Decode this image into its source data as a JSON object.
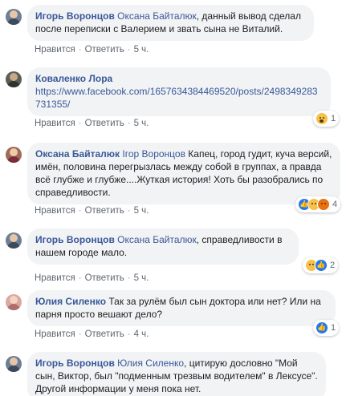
{
  "comments": [
    {
      "author": "Игорь Воронцов",
      "mention": "Оксана Байталюк",
      "text": ", данный вывод сделал после переписки с Валерием и звать сына не Виталий.",
      "like": "Нравится",
      "reply": "Ответить",
      "time": "5 ч."
    },
    {
      "author": "Коваленко Лора",
      "link": "https://www.facebook.com/1657634384469520/posts/2498349283731355/",
      "like": "Нравится",
      "reply": "Ответить",
      "time": "5 ч.",
      "reaction_count": "1"
    },
    {
      "author": "Оксана Байталюк",
      "mention": "Ігор Воронцов",
      "text": " Капец, город гудит, куча версий, имён, половина перегрызлась между собой в группах, а правда всё глубже и глубже....Жуткая история! Хоть бы разобрались по справедливости.",
      "like": "Нравится",
      "reply": "Ответить",
      "time": "5 ч.",
      "reaction_count": "4"
    },
    {
      "author": "Игорь Воронцов",
      "mention": "Оксана Байталюк",
      "text": ", справедливости в нашем городе мало.",
      "like": "Нравится",
      "reply": "Ответить",
      "time": "5 ч.",
      "reaction_count": "2"
    },
    {
      "author": "Юлия Силенко",
      "text": " Так за рулём был сын доктора или нет? Или на парня просто вешают дело?",
      "like": "Нравится",
      "reply": "Ответить",
      "time": "4 ч.",
      "reaction_count": "1"
    },
    {
      "author": "Игорь Воронцов",
      "mention": "Юлия Силенко",
      "text": ", цитирую дословно \"Мой сын, Виктор, был \"подменным трезвым водителем\" в Лексусе\". Другой информации у меня пока нет."
    }
  ],
  "colors": {
    "link": "#385898",
    "bubble": "#f2f3f5",
    "meta": "#606770",
    "like_blue": "#2078f4"
  }
}
